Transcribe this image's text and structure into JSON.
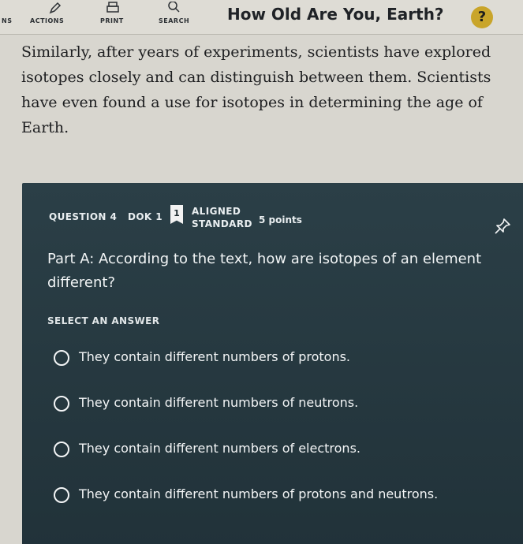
{
  "toolbar": {
    "items": [
      {
        "label": "NS",
        "icon": "none"
      },
      {
        "label": "ACTIONS",
        "icon": "pencil-icon"
      },
      {
        "label": "PRINT",
        "icon": "printer-icon"
      },
      {
        "label": "SEARCH",
        "icon": "search-icon"
      }
    ],
    "title": "How Old Are You, Earth?",
    "help_label": "?"
  },
  "passage": {
    "text": "Similarly, after years of experiments, scientists have explored isotopes closely and can distinguish between them. Scientists have even found a use for isotopes in determining the age of Earth."
  },
  "question": {
    "number_label": "QUESTION 4",
    "dok_label": "DOK 1",
    "badge": "1",
    "aligned_line1": "ALIGNED",
    "aligned_line2": "STANDARD",
    "points": "5 points",
    "prompt": "Part A: According to the text, how are isotopes of an element different?",
    "select_label": "SELECT AN ANSWER",
    "options": [
      "They contain different numbers of protons.",
      "They contain different numbers of neutrons.",
      "They contain different numbers of electrons.",
      "They contain different numbers of protons and neutrons."
    ]
  },
  "colors": {
    "panel": "#2b3f47",
    "help_accent": "#c9a52a",
    "text_light": "#f3f5f6"
  }
}
